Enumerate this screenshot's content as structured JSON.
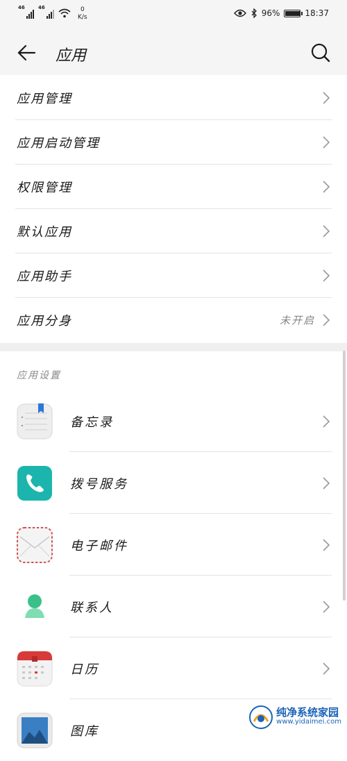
{
  "status_bar": {
    "signal_1": "46",
    "signal_2": "46",
    "net_speed_value": "0",
    "net_speed_unit": "K/s",
    "battery": "96%",
    "time": "18:37"
  },
  "header": {
    "title": "应用",
    "back_icon": "arrow-left-icon",
    "search_icon": "search-icon"
  },
  "menu": [
    {
      "label": "应用管理"
    },
    {
      "label": "应用启动管理"
    },
    {
      "label": "权限管理"
    },
    {
      "label": "默认应用"
    },
    {
      "label": "应用助手"
    },
    {
      "label": "应用分身",
      "value": "未开启"
    }
  ],
  "app_settings": {
    "header": "应用设置",
    "apps": [
      {
        "label": "备忘录",
        "icon": "notepad-icon"
      },
      {
        "label": "拨号服务",
        "icon": "phone-icon"
      },
      {
        "label": "电子邮件",
        "icon": "email-icon"
      },
      {
        "label": "联系人",
        "icon": "contacts-icon"
      },
      {
        "label": "日历",
        "icon": "calendar-icon"
      },
      {
        "label": "图库",
        "icon": "gallery-icon"
      }
    ]
  },
  "watermark": {
    "title": "纯净系统家园",
    "url": "www.yidaimei.com"
  },
  "colors": {
    "phone_icon": "#1bb5ad",
    "contacts_icon": "#3cc08a",
    "calendar_red": "#d83a3a",
    "watermark_blue": "#1a63b8"
  }
}
